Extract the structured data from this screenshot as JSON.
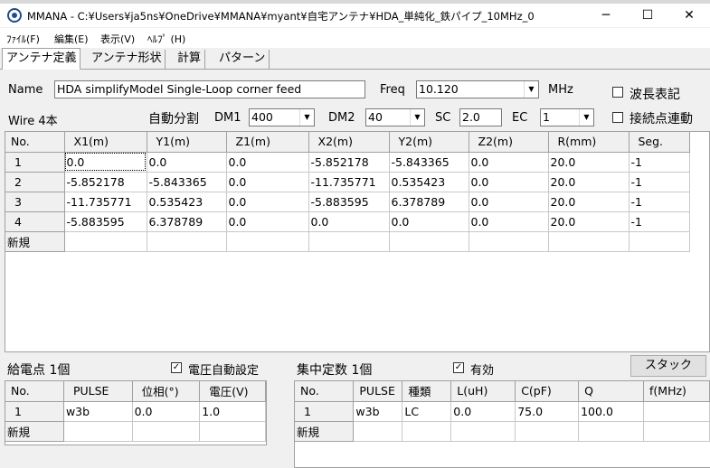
{
  "window": {
    "title": "MMANA - C:¥Users¥ja5ns¥OneDrive¥MMANA¥myant¥自宅アンテナ¥HDA_単純化_鉄パイプ_10MHz_0",
    "minimize": "─",
    "maximize": "☐",
    "close": "✕"
  },
  "menu": [
    "ﾌｧｲﾙ(F)",
    "編集(E)",
    "表示(V)",
    "ﾍﾙﾌﾟ (H)"
  ],
  "tabs": [
    "アンテナ定義",
    "アンテナ形状",
    "計算",
    "パターン"
  ],
  "antenna": {
    "name_label": "Name",
    "name_value": "HDA  simplifyModel  Single-Loop corner feed",
    "freq_label": "Freq",
    "freq_value": "10.120",
    "freq_unit": "MHz",
    "wavelength_label": "波長表記",
    "wavelength_checked": false
  },
  "wire_settings": {
    "wire_count": "Wire 4本",
    "auto_split": "自動分割",
    "dm1_label": "DM1",
    "dm1_value": "400",
    "dm2_label": "DM2",
    "dm2_value": "40",
    "sc_label": "SC",
    "sc_value": "2.0",
    "ec_label": "EC",
    "ec_value": "1",
    "link_label": "接続点連動",
    "link_checked": false
  },
  "wires": {
    "headers": [
      "No.",
      "X1(m)",
      "Y1(m)",
      "Z1(m)",
      "X2(m)",
      "Y2(m)",
      "Z2(m)",
      "R(mm)",
      "Seg."
    ],
    "rows": [
      [
        "1",
        "0.0",
        "0.0",
        "0.0",
        "-5.852178",
        "-5.843365",
        "0.0",
        "20.0",
        "-1"
      ],
      [
        "2",
        "-5.852178",
        "-5.843365",
        "0.0",
        "-11.735771",
        "0.535423",
        "0.0",
        "20.0",
        "-1"
      ],
      [
        "3",
        "-11.735771",
        "0.535423",
        "0.0",
        "-5.883595",
        "6.378789",
        "0.0",
        "20.0",
        "-1"
      ],
      [
        "4",
        "-5.883595",
        "6.378789",
        "0.0",
        "0.0",
        "0.0",
        "0.0",
        "20.0",
        "-1"
      ]
    ],
    "new_row": "新規"
  },
  "sources": {
    "title": "給電点 1個",
    "auto_voltage_label": "電圧自動設定",
    "auto_voltage_checked": true,
    "headers": [
      "No.",
      "PULSE",
      "位相(°)",
      "電圧(V)"
    ],
    "rows": [
      [
        "1",
        "w3b",
        "0.0",
        "1.0"
      ]
    ],
    "new_row": "新規"
  },
  "loads": {
    "title": "集中定数 1個",
    "enabled_label": "有効",
    "enabled_checked": true,
    "stack_button": "スタック",
    "headers": [
      "No.",
      "PULSE",
      "種類",
      "L(uH)",
      "C(pF)",
      "Q",
      "f(MHz)"
    ],
    "rows": [
      [
        "1",
        "w3b",
        "LC",
        "0.0",
        "75.0",
        "100.0",
        ""
      ]
    ],
    "new_row": "新規"
  }
}
